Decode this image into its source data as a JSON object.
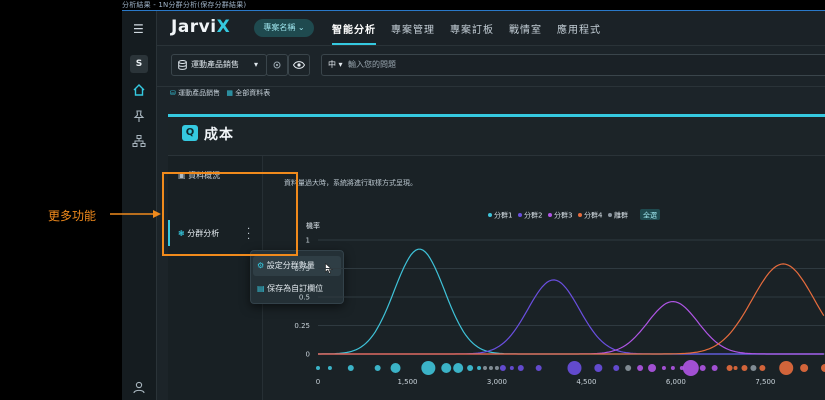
{
  "window": {
    "title": "分析結果 - 1N分群分析(保存分群結果)"
  },
  "rail": {
    "menu_icon": "menu-icon",
    "user_initial": "S",
    "icons": [
      "home-icon",
      "pin-icon",
      "hierarchy-icon",
      "user-icon"
    ]
  },
  "topnav": {
    "logo_main": "Jarvi",
    "logo_accent": "X",
    "project_pill": "專案名稱 ⌄",
    "tabs": [
      {
        "label": "智能分析",
        "active": true
      },
      {
        "label": "專案管理",
        "active": false
      },
      {
        "label": "專案訂板",
        "active": false
      },
      {
        "label": "戰情室",
        "active": false
      },
      {
        "label": "應用程式",
        "active": false
      }
    ]
  },
  "toolbar": {
    "dataset_select": "運動產品銷售",
    "dataset_caret": "▾",
    "lang": "中 ▾",
    "question_placeholder": "輸入您的問題"
  },
  "breadcrumbs": {
    "dataset": "運動產品銷售",
    "table": "全部資料表"
  },
  "panel": {
    "badge": "Q",
    "title": "成本",
    "subnav": {
      "overview": "資料概況",
      "cluster": "分群分析"
    },
    "context_menu": {
      "set_count": "設定分群數量",
      "save_as_field": "保存為自訂欄位"
    },
    "note": "資料量過大時，系統將進行取樣方式呈現。"
  },
  "annotation": {
    "label": "更多功能"
  },
  "colors": {
    "accent": "#35c9e0",
    "annotation": "#f08a1c"
  },
  "chart_data": {
    "type": "line",
    "ylabel": "機率",
    "yticks": [
      "1",
      "0.75",
      "0.5",
      "0.25",
      "0"
    ],
    "ylim": [
      0,
      1.05
    ],
    "xticks": [
      "0",
      "1,500",
      "3,000",
      "4,500",
      "6,000",
      "7,500"
    ],
    "xlim": [
      0,
      8500
    ],
    "grid": true,
    "legend_position": "top",
    "legend": [
      "分群1",
      "分群2",
      "分群3",
      "分群4",
      "離群",
      "全選"
    ],
    "series": [
      {
        "name": "分群1",
        "color": "#3fc3d9",
        "mean": 1700,
        "sd": 420,
        "peak": 0.92
      },
      {
        "name": "分群2",
        "color": "#6a4fe0",
        "mean": 3950,
        "sd": 430,
        "peak": 0.65
      },
      {
        "name": "分群3",
        "color": "#b055e6",
        "mean": 5950,
        "sd": 420,
        "peak": 0.46
      },
      {
        "name": "分群4",
        "color": "#e76c3d",
        "mean": 7800,
        "sd": 520,
        "peak": 0.79
      }
    ],
    "points": [
      {
        "x": 0,
        "r": 2,
        "s": 0
      },
      {
        "x": 200,
        "r": 2,
        "s": 0
      },
      {
        "x": 550,
        "r": 3,
        "s": 0
      },
      {
        "x": 1000,
        "r": 3,
        "s": 0
      },
      {
        "x": 1300,
        "r": 5,
        "s": 0
      },
      {
        "x": 1850,
        "r": 7,
        "s": 0
      },
      {
        "x": 2150,
        "r": 5,
        "s": 0
      },
      {
        "x": 2350,
        "r": 5,
        "s": 0
      },
      {
        "x": 2550,
        "r": 3,
        "s": 0
      },
      {
        "x": 2700,
        "r": 2,
        "s": 0
      },
      {
        "x": 2800,
        "r": 2,
        "s": 4
      },
      {
        "x": 2900,
        "r": 2,
        "s": 4
      },
      {
        "x": 3000,
        "r": 2,
        "s": 4
      },
      {
        "x": 3100,
        "r": 3,
        "s": 1
      },
      {
        "x": 3250,
        "r": 2,
        "s": 1
      },
      {
        "x": 3400,
        "r": 3,
        "s": 1
      },
      {
        "x": 3700,
        "r": 3,
        "s": 1
      },
      {
        "x": 4300,
        "r": 7,
        "s": 1
      },
      {
        "x": 4700,
        "r": 4,
        "s": 1
      },
      {
        "x": 5000,
        "r": 3,
        "s": 1
      },
      {
        "x": 5200,
        "r": 3,
        "s": 4
      },
      {
        "x": 5400,
        "r": 3,
        "s": 2
      },
      {
        "x": 5600,
        "r": 4,
        "s": 2
      },
      {
        "x": 5800,
        "r": 2,
        "s": 2
      },
      {
        "x": 5950,
        "r": 2,
        "s": 2
      },
      {
        "x": 6100,
        "r": 2,
        "s": 2
      },
      {
        "x": 6250,
        "r": 8,
        "s": 2
      },
      {
        "x": 6450,
        "r": 3,
        "s": 2
      },
      {
        "x": 6650,
        "r": 3,
        "s": 2
      },
      {
        "x": 6900,
        "r": 3,
        "s": 3
      },
      {
        "x": 7000,
        "r": 2,
        "s": 3
      },
      {
        "x": 7150,
        "r": 3,
        "s": 3
      },
      {
        "x": 7300,
        "r": 3,
        "s": 4
      },
      {
        "x": 7450,
        "r": 3,
        "s": 3
      },
      {
        "x": 7850,
        "r": 7,
        "s": 3
      },
      {
        "x": 8150,
        "r": 4,
        "s": 3
      },
      {
        "x": 8500,
        "r": 4,
        "s": 3
      }
    ]
  }
}
